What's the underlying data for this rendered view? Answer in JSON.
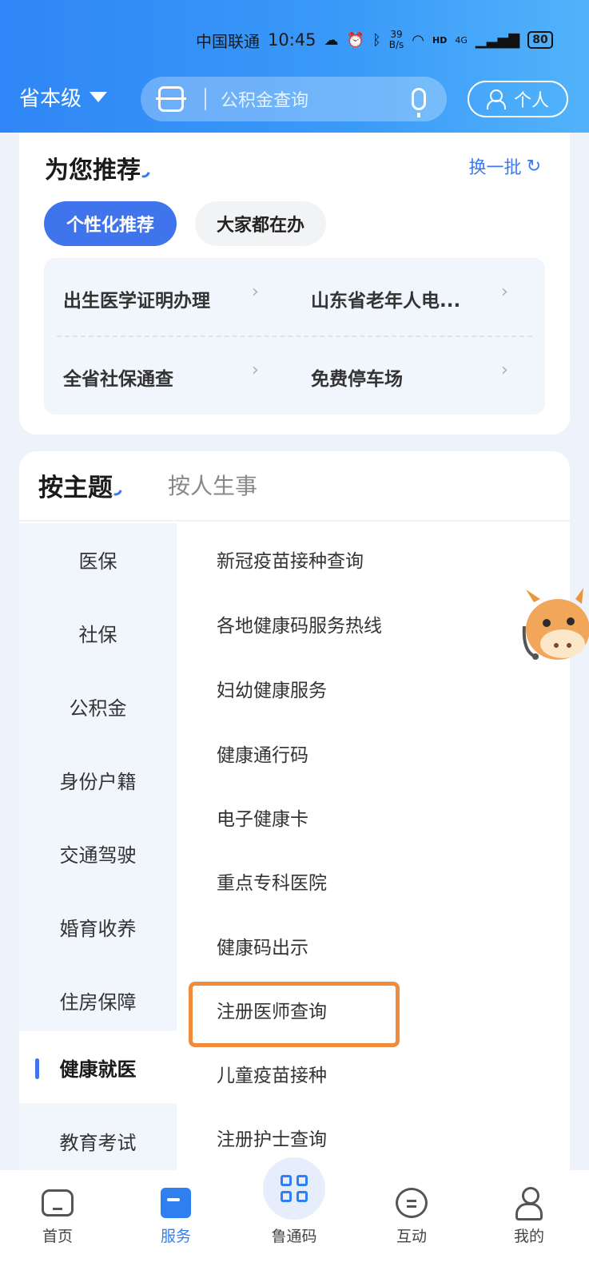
{
  "status_bar": {
    "carrier": "中国联通",
    "time": "10:45",
    "net_speed_value": "39",
    "net_speed_unit": "B/s",
    "signal_label": "4G",
    "battery": "80"
  },
  "header": {
    "region": "省本级",
    "search_placeholder": "公积金查询",
    "personal_label": "个人"
  },
  "recommend": {
    "title": "为您推荐",
    "refresh_label": "换一批",
    "tabs": [
      "个性化推荐",
      "大家都在办"
    ],
    "items": [
      "出生医学证明办理",
      "山东省老年人电...",
      "全省社保通查",
      "免费停车场"
    ]
  },
  "theme": {
    "tabs": [
      "按主题",
      "按人生事"
    ],
    "categories": [
      "医保",
      "社保",
      "公积金",
      "身份户籍",
      "交通驾驶",
      "婚育收养",
      "住房保障",
      "健康就医",
      "教育考试"
    ],
    "active_category": "健康就医",
    "services": [
      "新冠疫苗接种查询",
      "各地健康码服务热线",
      "妇幼健康服务",
      "健康通行码",
      "电子健康卡",
      "重点专科医院",
      "健康码出示",
      "注册医师查询",
      "儿童疫苗接种",
      "注册护士查询"
    ]
  },
  "bottom_nav": [
    {
      "label": "首页",
      "icon": "home-icon"
    },
    {
      "label": "服务",
      "icon": "service-icon"
    },
    {
      "label": "鲁通码",
      "icon": "grid-icon"
    },
    {
      "label": "互动",
      "icon": "chat-icon"
    },
    {
      "label": "我的",
      "icon": "user-icon"
    }
  ],
  "colors": {
    "accent": "#3f74ec",
    "header_start": "#2f86f6",
    "header_end": "#52b3fb",
    "highlight": "#f08a3c"
  }
}
